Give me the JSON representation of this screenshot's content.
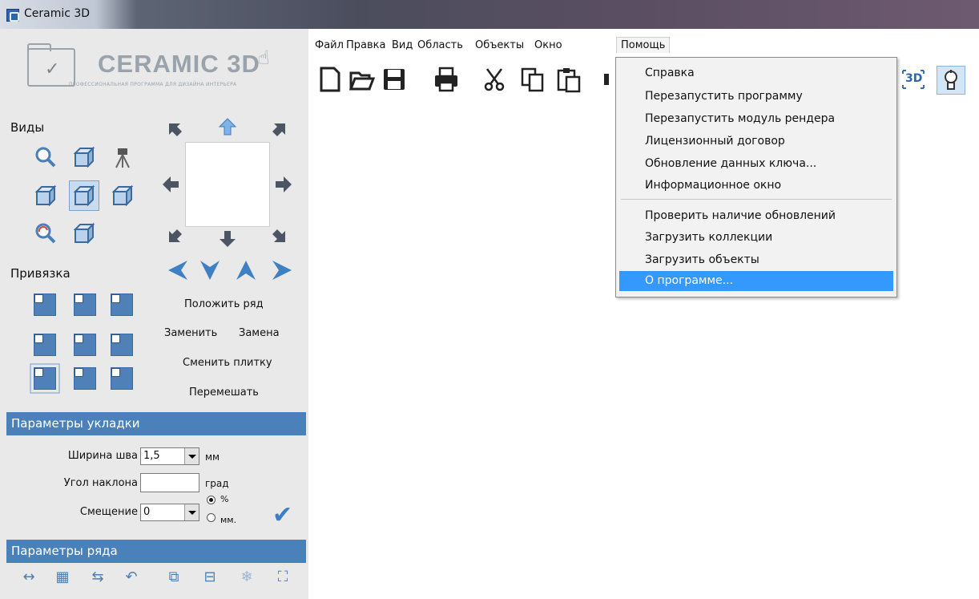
{
  "window": {
    "title": "Ceramic 3D"
  },
  "logo": {
    "name": "CERAMIC 3D",
    "tagline": "ПРОФЕССИОНАЛЬНАЯ ПРОГРАММА ДЛЯ ДИЗАЙНА ИНТЕРЬЕРА"
  },
  "menu": [
    "Файл",
    "Правка",
    "Вид",
    "Область",
    "Объекты",
    "Окно",
    "Помощь"
  ],
  "help_menu": {
    "items": [
      "Справка",
      "Перезапустить программу",
      "Перезапустить модуль рендера",
      "Лицензионный договор",
      "Обновление данных ключа...",
      "Информационное окно",
      "Проверить наличие обновлений",
      "Загрузить коллекции",
      "Загрузить объекты",
      "О программе..."
    ],
    "highlighted": "О программе..."
  },
  "toolbar": {
    "icons": [
      "new-file-icon",
      "open-folder-icon",
      "save-icon",
      "print-icon",
      "cut-icon",
      "copy-icon",
      "paste-icon",
      "view-3d-icon",
      "light-bulb-icon"
    ],
    "view_3d_label": "3D"
  },
  "left_panel": {
    "views_label": "Виды",
    "snap_label": "Привязка",
    "actions": {
      "lay_row": "Положить ряд",
      "replace": "Заменить",
      "replacement": "Замена",
      "change_tile": "Сменить плитку",
      "shuffle": "Перемешать"
    },
    "layout_params": {
      "header": "Параметры укладки",
      "joint_width_label": "Ширина шва",
      "joint_width_value": "1,5",
      "joint_width_unit": "мм",
      "angle_label": "Угол наклона",
      "angle_value": "",
      "angle_unit": "град",
      "offset_label": "Смещение",
      "offset_value": "0",
      "offset_percent": "%",
      "offset_mm": "мм.",
      "offset_unit_selected": "%"
    },
    "row_params": {
      "header": "Параметры ряда"
    }
  },
  "colors": {
    "accent": "#4a81bb",
    "menu_highlight": "#3399ff",
    "panel_bg": "#e9e9e9"
  }
}
